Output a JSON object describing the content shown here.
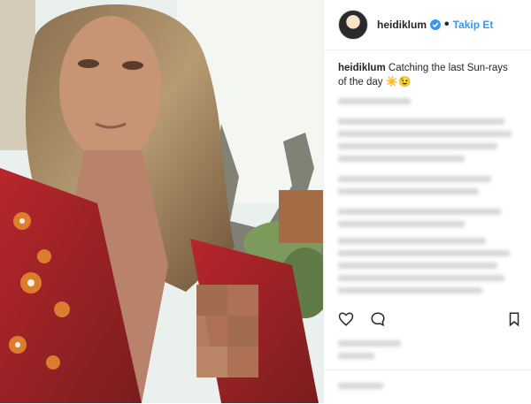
{
  "header": {
    "username": "heidiklum",
    "follow_label": "Takip Et",
    "dot": "•"
  },
  "caption": {
    "username": "heidiklum",
    "text": "Catching the last Sun-rays of the day",
    "emoji": "☀️😉"
  },
  "colors": {
    "accent": "#3897f0",
    "text": "#262626",
    "blur": "#d6d6d6"
  },
  "icons": [
    "verified-badge-icon",
    "heart-icon",
    "comment-icon",
    "save-icon"
  ]
}
